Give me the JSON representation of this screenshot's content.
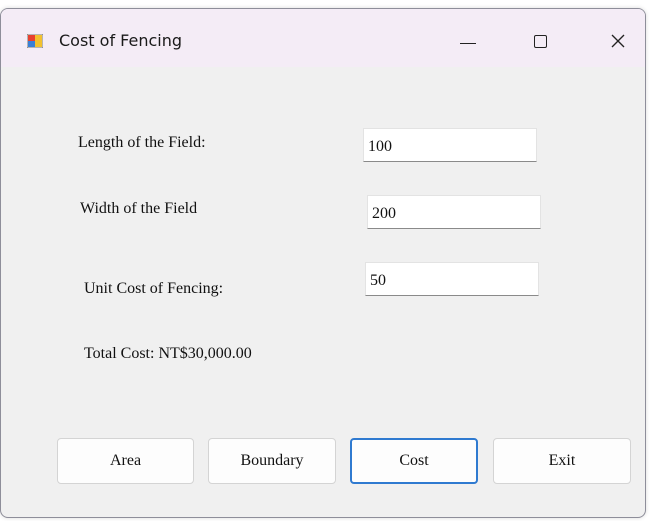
{
  "window": {
    "title": "Cost of Fencing",
    "controls": {
      "minimize": "minimize-icon",
      "maximize": "maximize-icon",
      "close": "close-icon"
    }
  },
  "form": {
    "length_label": "Length of the Field:",
    "length_value": "100",
    "width_label": "Width of the Field",
    "width_value": "200",
    "unit_cost_label": "Unit Cost of Fencing:",
    "unit_cost_value": "50",
    "total_cost_text": "Total Cost: NT$30,000.00"
  },
  "buttons": {
    "area": "Area",
    "boundary": "Boundary",
    "cost": "Cost",
    "exit": "Exit"
  },
  "colors": {
    "titlebar": "#f4ecf6",
    "client": "#f0f0f0",
    "focus_border": "#2f7ad0"
  }
}
